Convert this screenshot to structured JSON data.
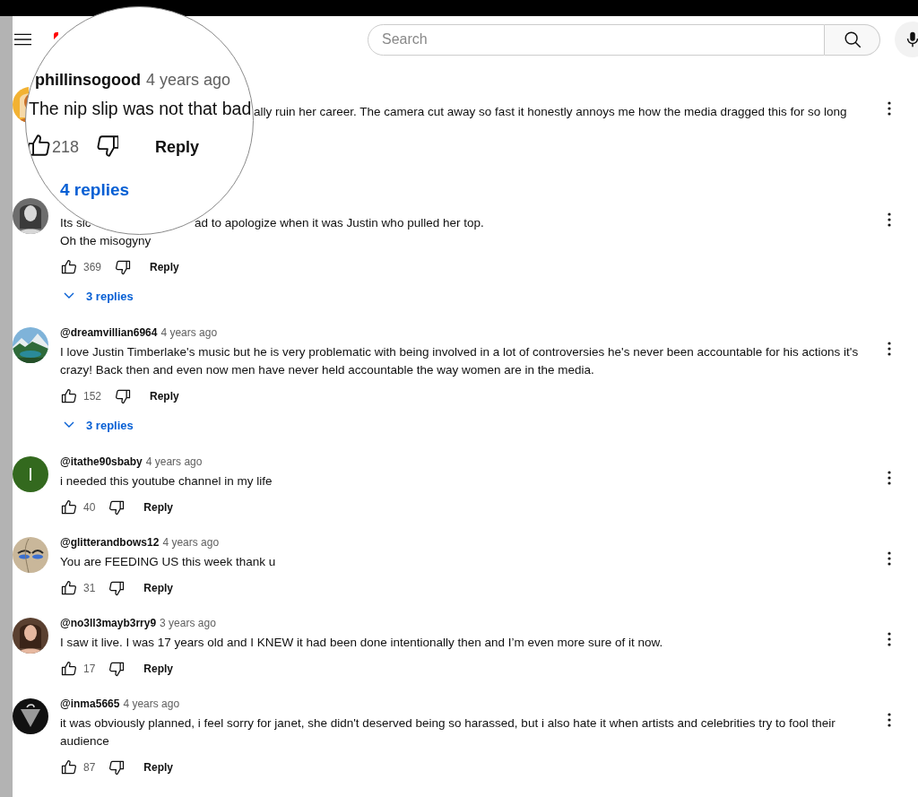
{
  "header": {
    "search_placeholder": "Search"
  },
  "magnifier": {
    "author": "phillinsogood",
    "time": "4 years ago",
    "text": "The nip slip was not that bad",
    "likes": "218",
    "reply": "Reply",
    "replies": "4 replies"
  },
  "comments": [
    {
      "kind": "covered",
      "avatar": {
        "kind": "picture"
      },
      "lines": [
        {
          "kind": "after_lens",
          "segments": [
            "ally ruin her career. The camera cut away so fast it honestly annoys me how the media dragged this for so long"
          ]
        }
      ]
    },
    {
      "kind": "normal",
      "avatar": {
        "kind": "picture"
      },
      "lines": [
        {
          "kind": "split",
          "segments": [
            "Its sic",
            "ad to apologize when it was Justin who pulled her top."
          ]
        },
        {
          "kind": "full",
          "segments": [
            "Oh the misogyny"
          ]
        }
      ],
      "likes": "369",
      "reply": "Reply",
      "replies": "3 replies"
    },
    {
      "kind": "normal",
      "author": "@dreamvillian6964",
      "time": "4 years ago",
      "avatar": {
        "kind": "picture"
      },
      "lines": [
        {
          "kind": "full",
          "segments": [
            "I love Justin Timberlake's music but he is very problematic with being involved in a lot of controversies he's never been accountable for his actions it's crazy! Back then and even now men have never held accountable the way women are in the media."
          ]
        }
      ],
      "likes": "152",
      "reply": "Reply",
      "replies": "3 replies"
    },
    {
      "kind": "normal",
      "author": "@itathe90sbaby",
      "time": "4 years ago",
      "avatar": {
        "kind": "letter",
        "letter": "I",
        "color": "#33691e"
      },
      "lines": [
        {
          "kind": "full",
          "segments": [
            "i needed this youtube channel in my life"
          ]
        }
      ],
      "likes": "40",
      "reply": "Reply"
    },
    {
      "kind": "normal",
      "author": "@glitterandbows12",
      "time": "4 years ago",
      "avatar": {
        "kind": "picture"
      },
      "lines": [
        {
          "kind": "full",
          "segments": [
            "You are FEEDING US this week thank u"
          ]
        }
      ],
      "likes": "31",
      "reply": "Reply"
    },
    {
      "kind": "normal",
      "author": "@no3ll3mayb3rry9",
      "time": "3 years ago",
      "avatar": {
        "kind": "picture"
      },
      "lines": [
        {
          "kind": "full",
          "segments": [
            "I saw it live. I was 17 years old and I KNEW it had been done intentionally then and I’m even more sure of it now."
          ]
        }
      ],
      "likes": "17",
      "reply": "Reply"
    },
    {
      "kind": "normal",
      "author": "@inma5665",
      "time": "4 years ago",
      "avatar": {
        "kind": "picture"
      },
      "lines": [
        {
          "kind": "full",
          "segments": [
            "it was obviously planned, i feel sorry for janet, she didn't deserved being so harassed, but i also hate it when artists and celebrities try to fool their audience"
          ]
        }
      ],
      "likes": "87",
      "reply": "Reply"
    }
  ]
}
